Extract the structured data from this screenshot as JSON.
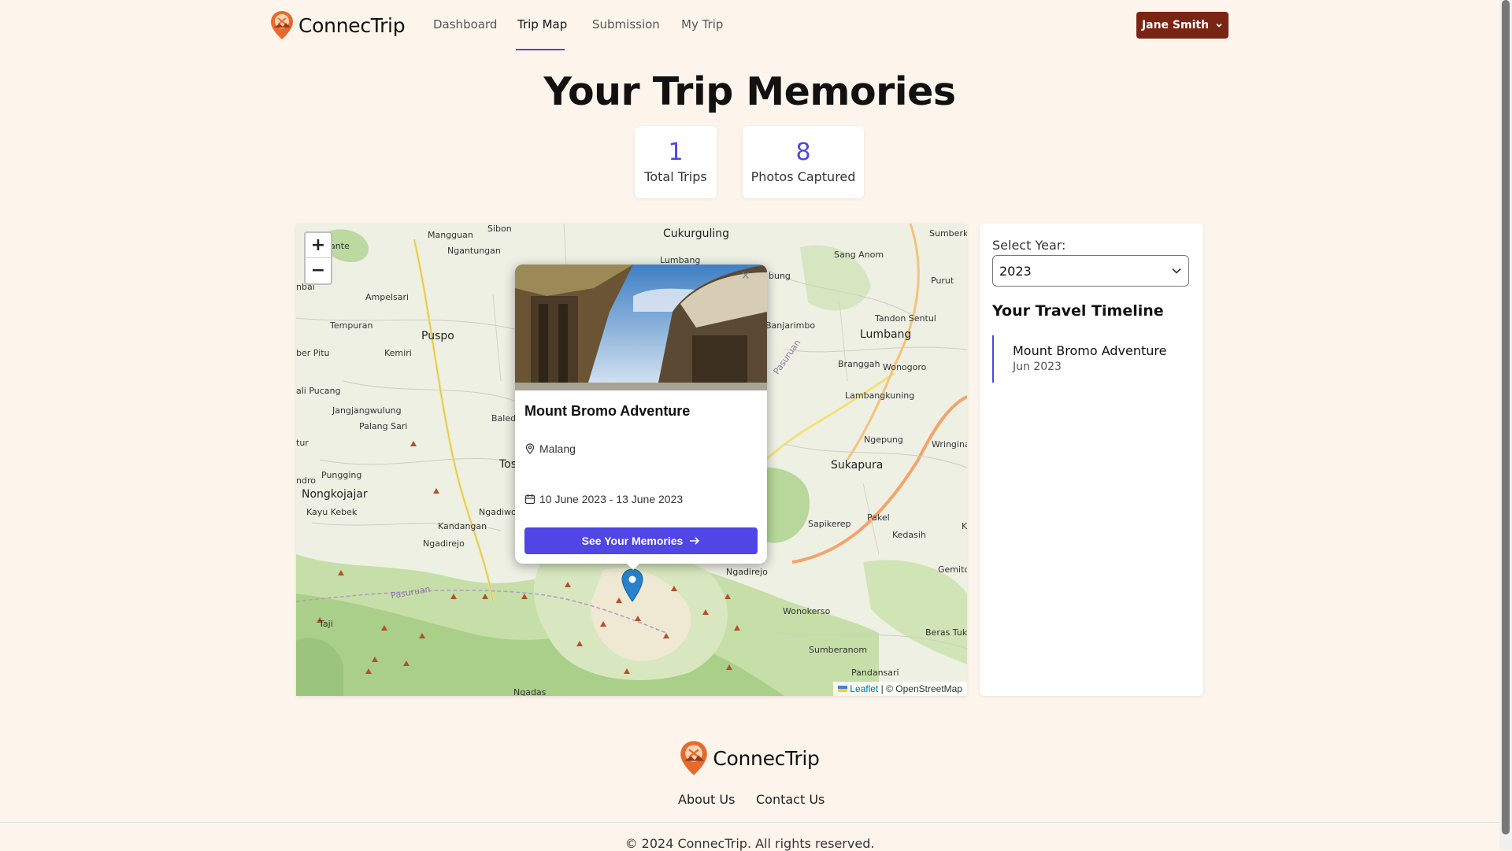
{
  "brand": {
    "name": "ConnecTrip"
  },
  "nav": {
    "links": [
      "Dashboard",
      "Trip Map",
      "Submission",
      "My Trip"
    ],
    "active": "Trip Map",
    "user": "Jane Smith"
  },
  "page": {
    "title": "Your Trip Memories"
  },
  "stats": [
    {
      "value": "1",
      "label": "Total Trips"
    },
    {
      "value": "8",
      "label": "Photos Captured"
    }
  ],
  "map": {
    "zoom_in": "+",
    "zoom_out": "−",
    "attribution_leaflet": "Leaflet",
    "attribution_osm": "| © OpenStreetMap",
    "place_labels": [
      "Mangguan",
      "Sibon",
      "Cukurguling",
      "Sumberkr",
      "Ngantungan",
      "Lumbang",
      "bung",
      "Sang Anom",
      "Purut",
      "Ampelsari",
      "Tempuran",
      "Puspo",
      "Banjarimbo",
      "Tandon Sentul",
      "Lumbang",
      "ber Pitu",
      "Kemiri",
      "Branggah",
      "Wonogoro",
      "ali Pucang",
      "Lambangkuning",
      "Jangjangwulung",
      "Palang Sari",
      "Baled",
      "Ngepung",
      "Wringinar",
      "Tos",
      "Sukapura",
      "Pungging",
      "Nongkojajar",
      "Kayu Kebek",
      "Ngadiwo",
      "Kandangan",
      "Ngadirejo",
      "Sapikerep",
      "Pakel",
      "Kedasih",
      "Gemito",
      "Ngadirejo",
      "Wonokerso",
      "Taji",
      "Beras Tukul",
      "Sumberanom",
      "Pandansari",
      "Ngadas",
      "lante",
      "nbal",
      "tur",
      "ndro",
      "K",
      "Pasuruan",
      "Pasuruan"
    ],
    "pin_icon": "map-pin-icon",
    "marker_color": "#2a81cb"
  },
  "popup": {
    "title": "Mount Bromo Adventure",
    "location": "Malang",
    "dates": "10 June 2023 - 13 June 2023",
    "cta": "See Your Memories",
    "close": "×"
  },
  "panel": {
    "select_label": "Select Year:",
    "selected_year": "2023",
    "timeline_title": "Your Travel Timeline",
    "timeline": [
      {
        "name": "Mount Bromo Adventure",
        "date": "Jun 2023"
      }
    ]
  },
  "footer": {
    "links": [
      "About Us",
      "Contact Us"
    ],
    "copyright": "© 2024 ConnecTrip. All rights reserved."
  },
  "colors": {
    "accent": "#4f46e5",
    "user_button": "#7a2413",
    "background": "#fdf5ec"
  }
}
